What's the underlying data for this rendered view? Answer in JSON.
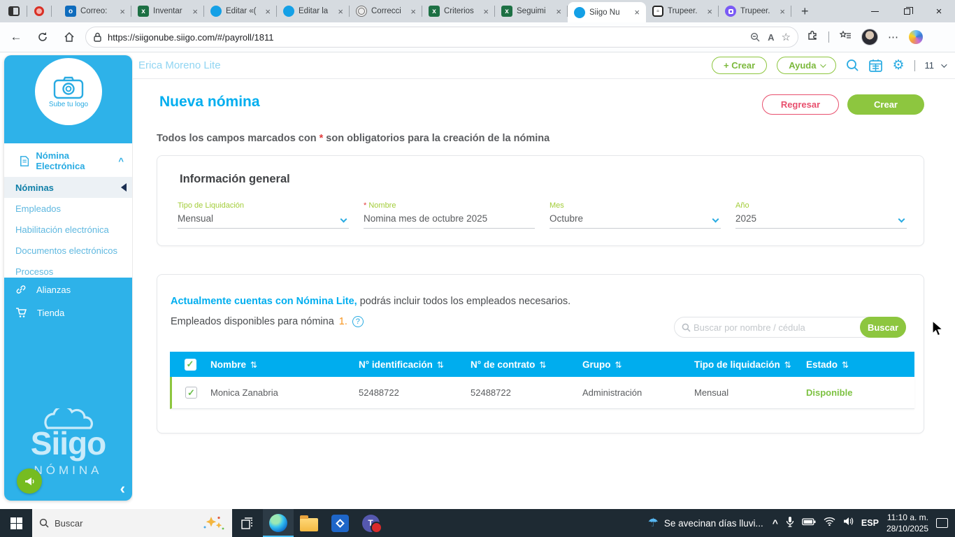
{
  "glyphs": {
    "close": "×",
    "back": "←",
    "star": "☆",
    "sort": "⇅",
    "gear": "⚙",
    "collapse": "‹",
    "caret_up": "^",
    "dots": "⋯",
    "check": "✓",
    "question": "?",
    "umbrella": "☂",
    "hidden_icons": "^",
    "newtab": "+",
    "teams_letter": "T"
  },
  "colors": {
    "siigo_blue": "#00AEEF",
    "sidebar_blue": "#2EB2E9",
    "green": "#8DC63F",
    "red": "#E8506E",
    "orange": "#F7941D",
    "table_header": "#00ADEE"
  },
  "browser": {
    "tabs": [
      {
        "label": "Correo:"
      },
      {
        "label": "Inventar"
      },
      {
        "label": "Editar «("
      },
      {
        "label": "Editar la"
      },
      {
        "label": "Correcci"
      },
      {
        "label": "Criterios"
      },
      {
        "label": "Seguimi"
      },
      {
        "label": "Siigo Nu"
      },
      {
        "label": "Trupeer."
      },
      {
        "label": "Trupeer."
      }
    ],
    "url": "https://siigonube.siigo.com/#/payroll/1811",
    "read_aloud": "A"
  },
  "appbar": {
    "company": "Erica Moreno Lite",
    "crear": "+ Crear",
    "ayuda": "Ayuda",
    "sessions": "11"
  },
  "sidebar": {
    "logo_label": "Sube tu logo",
    "module": "Nómina Electrónica",
    "items": [
      "Nóminas",
      "Empleados",
      "Habilitación electrónica",
      "Documentos electrónicos",
      "Procesos"
    ],
    "footer_items": [
      "Alianzas",
      "Tienda"
    ],
    "brand": "Siigo",
    "brand_sub": "NÓMINA"
  },
  "page": {
    "title": "Nueva nómina",
    "regresar": "Regresar",
    "crear": "Crear",
    "note_pre": "Todos los campos marcados con ",
    "note_ast": "*",
    "note_post": " son obligatorios para la creación de la nómina",
    "info_card": {
      "title": "Información general",
      "fields": [
        {
          "label": "Tipo de Liquidación",
          "value": "Mensual"
        },
        {
          "req": "* ",
          "label": "Nombre",
          "value": "Nomina mes de octubre 2025"
        },
        {
          "label": "Mes",
          "value": "Octubre"
        },
        {
          "label": "Año",
          "value": "2025"
        }
      ]
    },
    "employees_card": {
      "headline_strong": "Actualmente cuentas con Nómina Lite,",
      "headline_rest": " podrás incluir todos los empleados necesarios.",
      "available_pre": "Empleados disponibles para nómina ",
      "available_count": "1.",
      "search_placeholder": "Buscar por nombre / cédula",
      "search_button": "Buscar"
    },
    "table": {
      "columns": [
        "Nombre",
        "N° identificación",
        "N° de contrato",
        "Grupo",
        "Tipo de liquidación",
        "Estado"
      ],
      "rows": [
        {
          "nombre": "Monica Zanabria",
          "identificacion": "52488722",
          "contrato": "52488722",
          "grupo": "Administración",
          "tipo": "Mensual",
          "estado": "Disponible"
        }
      ]
    }
  },
  "taskbar": {
    "search_placeholder": "Buscar",
    "weather": "Se avecinan días lluvi...",
    "lang": "ESP",
    "time": "11:10 a. m.",
    "date": "28/10/2025"
  }
}
